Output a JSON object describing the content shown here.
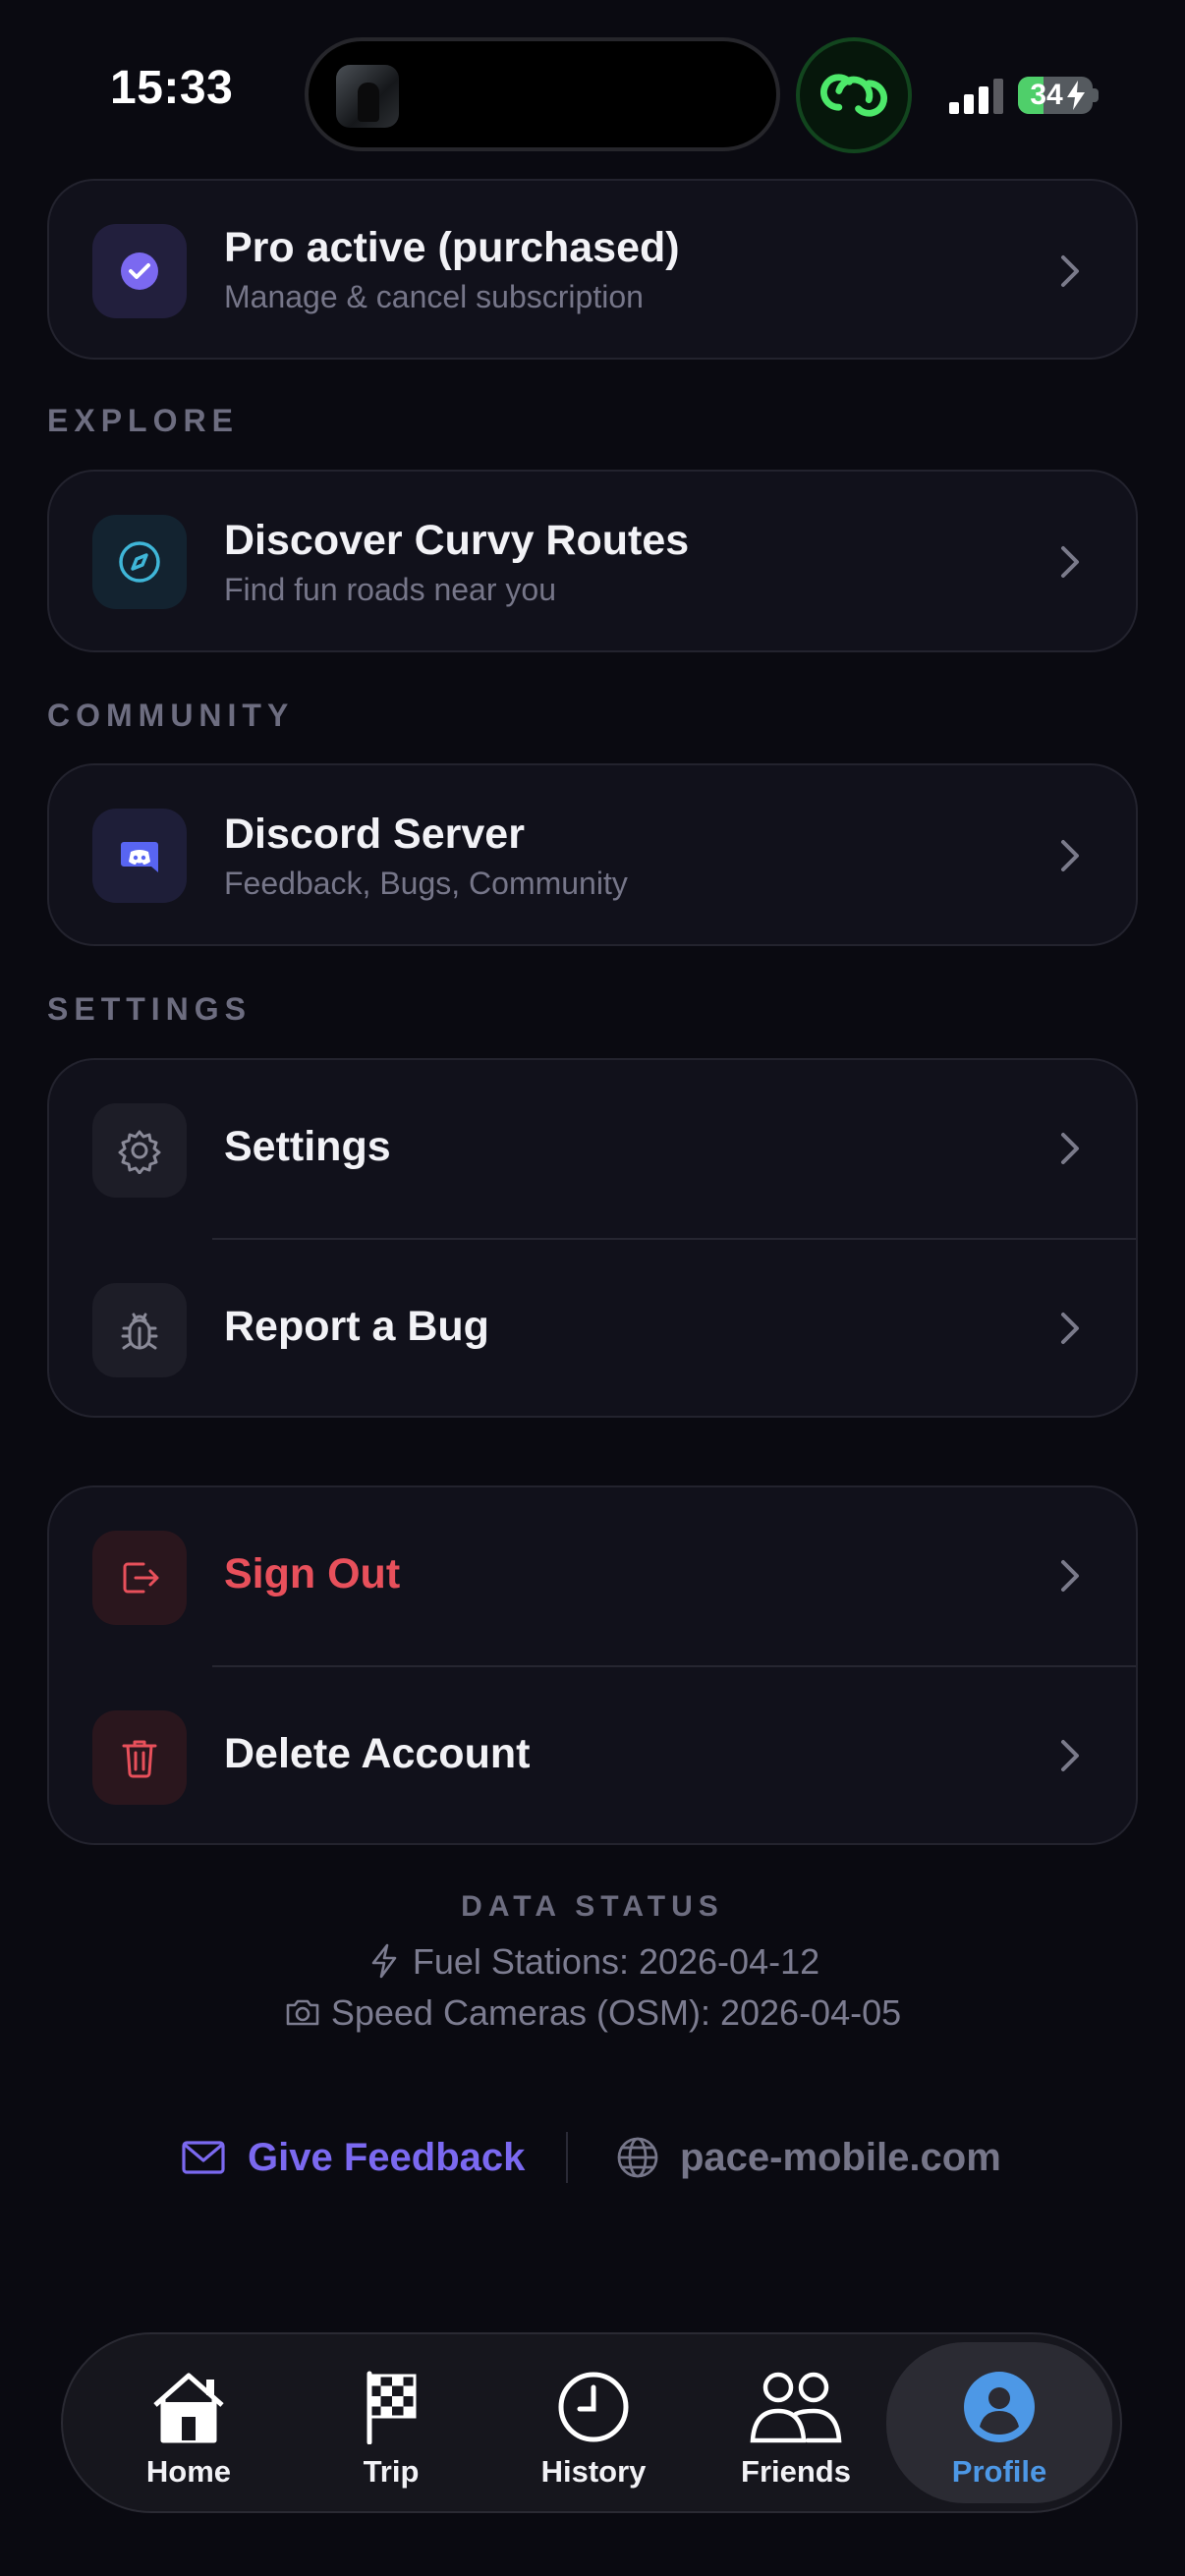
{
  "status_bar": {
    "time": "15:33",
    "battery": "34"
  },
  "pro_card": {
    "title": "Pro active (purchased)",
    "subtitle": "Manage & cancel subscription"
  },
  "explore": {
    "section_label": "EXPLORE",
    "item": {
      "title": "Discover Curvy Routes",
      "subtitle": "Find fun roads near you"
    }
  },
  "community": {
    "section_label": "COMMUNITY",
    "item": {
      "title": "Discord Server",
      "subtitle": "Feedback, Bugs, Community"
    }
  },
  "settings": {
    "section_label": "SETTINGS",
    "items": [
      {
        "title": "Settings"
      },
      {
        "title": "Report a Bug"
      }
    ]
  },
  "account": {
    "items": [
      {
        "title": "Sign Out"
      },
      {
        "title": "Delete Account"
      }
    ]
  },
  "data_status": {
    "title": "DATA STATUS",
    "fuel": "Fuel Stations: 2026-04-12",
    "cameras": "Speed Cameras (OSM): 2026-04-05"
  },
  "footer": {
    "feedback": "Give Feedback",
    "website": "pace-mobile.com"
  },
  "tabs": [
    {
      "label": "Home"
    },
    {
      "label": "Trip"
    },
    {
      "label": "History"
    },
    {
      "label": "Friends"
    },
    {
      "label": "Profile",
      "active": true
    }
  ],
  "colors": {
    "background": "#0a0a11",
    "card": "#11111b",
    "accent_purple": "#7b69f0",
    "danger": "#e8505b",
    "active_tab": "#4d98e6",
    "explore_icon": "#3fb6d8",
    "link_green": "#4de86a"
  }
}
